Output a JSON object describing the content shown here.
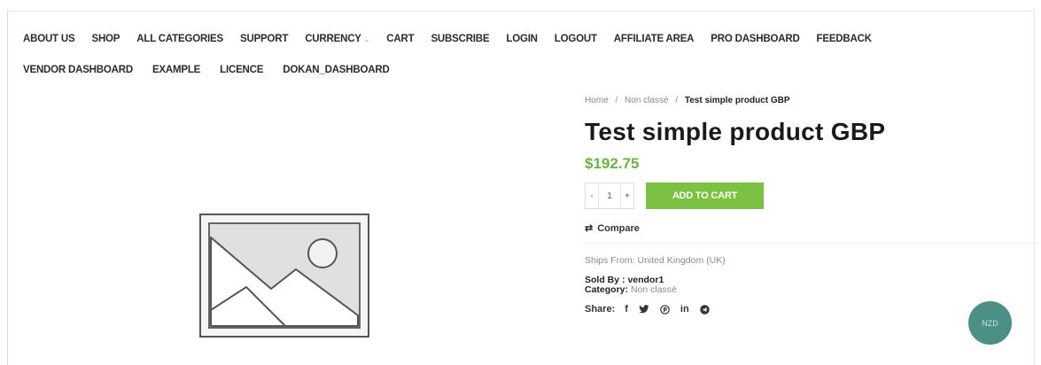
{
  "nav": {
    "row1": [
      "ABOUT US",
      "SHOP",
      "ALL CATEGORIES",
      "SUPPORT",
      "CURRENCY",
      "CART",
      "SUBSCRIBE",
      "LOGIN",
      "LOGOUT",
      "AFFILIATE AREA",
      "PRO DASHBOARD",
      "FEEDBACK"
    ],
    "row2": [
      "VENDOR DASHBOARD",
      "EXAMPLE",
      "LICENCE",
      "DOKAN_DASHBOARD"
    ],
    "currency_has_dropdown": true
  },
  "breadcrumb": {
    "home": "Home",
    "separator": "/",
    "category": "Non classé",
    "current": "Test simple product GBP"
  },
  "product": {
    "title": "Test simple product GBP",
    "price": "$192.75",
    "quantity": "1",
    "qty_minus": "-",
    "qty_plus": "+",
    "add_to_cart": "ADD TO CART",
    "compare": "Compare",
    "ships_from": "Ships From: United Kingdom (UK)",
    "sold_by_label": "Sold By :",
    "sold_by_value": "vendor1",
    "category_label": "Category:",
    "category_value": "Non classé",
    "share_label": "Share:"
  },
  "share_icons": [
    "facebook-icon",
    "twitter-icon",
    "pinterest-icon",
    "linkedin-icon",
    "telegram-icon"
  ],
  "currency_badge": "NZD",
  "colors": {
    "accent_green": "#7cc242",
    "price_green": "#6cb33f",
    "badge_teal": "#4b8f86"
  }
}
